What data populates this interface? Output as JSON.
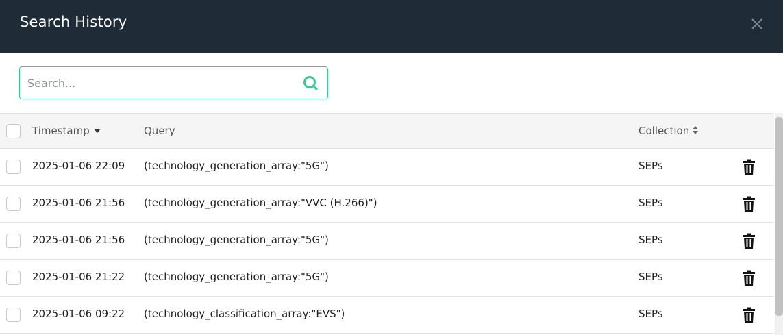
{
  "header": {
    "title": "Search History",
    "close_icon": "close-icon"
  },
  "search": {
    "value": "",
    "placeholder": "Search...",
    "icon": "search-icon",
    "accent_color": "#3cc79a"
  },
  "table": {
    "columns": {
      "timestamp": "Timestamp",
      "query": "Query",
      "collection": "Collection"
    },
    "timestamp_sort": "descending",
    "collection_sort": "unsorted",
    "rows": [
      {
        "timestamp": "2025-01-06 22:09",
        "query": "(technology_generation_array:\"5G\")",
        "collection": "SEPs"
      },
      {
        "timestamp": "2025-01-06 21:56",
        "query": "(technology_generation_array:\"VVC (H.266)\")",
        "collection": "SEPs"
      },
      {
        "timestamp": "2025-01-06 21:56",
        "query": "(technology_generation_array:\"5G\")",
        "collection": "SEPs"
      },
      {
        "timestamp": "2025-01-06 21:22",
        "query": "(technology_generation_array:\"5G\")",
        "collection": "SEPs"
      },
      {
        "timestamp": "2025-01-06 09:22",
        "query": "(technology_classification_array:\"EVS\")",
        "collection": "SEPs"
      }
    ],
    "row_action_icon": "trash-icon"
  },
  "colors": {
    "header_bg": "#1f2b36",
    "table_header_bg": "#f5f5f5"
  }
}
